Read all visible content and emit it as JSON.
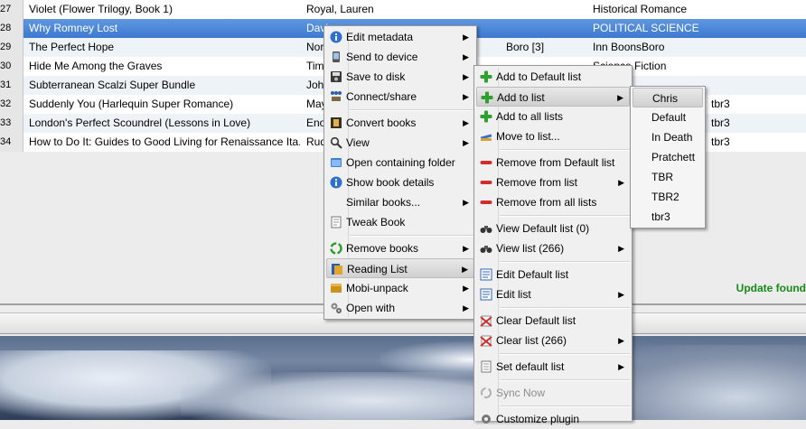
{
  "books": [
    {
      "num": "27",
      "title": "Violet (Flower Trilogy, Book 1)",
      "author": "Royal, Lauren",
      "series_num": "",
      "tags": "Historical Romance",
      "extra": ""
    },
    {
      "num": "28",
      "title": "Why Romney Lost",
      "author": "Davi",
      "series_num": "",
      "tags": "POLITICAL SCIENCE",
      "extra": ""
    },
    {
      "num": "29",
      "title": "The Perfect Hope",
      "author": "Nor",
      "series_num": "Boro [3]",
      "tags": "Inn BoonsBoro",
      "extra": ""
    },
    {
      "num": "30",
      "title": "Hide Me Among the Graves",
      "author": "Tim",
      "series_num": "",
      "tags": "Science Fiction",
      "extra": ""
    },
    {
      "num": "31",
      "title": "Subterranean Scalzi Super Bundle",
      "author": "John",
      "series_num": "",
      "tags": "Fiction",
      "extra": ""
    },
    {
      "num": "32",
      "title": "Suddenly You (Harlequin Super Romance)",
      "author": "May",
      "series_num": "",
      "tags": "",
      "extra": "tbr3"
    },
    {
      "num": "33",
      "title": "London's Perfect Scoundrel (Lessons in Love)",
      "author": "Eno",
      "series_num": "",
      "tags": "",
      "extra": "tbr3"
    },
    {
      "num": "34",
      "title": "How to Do It: Guides to Good Living for Renaissance Ita...",
      "author": "Rud",
      "series_num": "",
      "tags": "",
      "extra": "tbr3"
    }
  ],
  "status_text": "Update found",
  "context_menu": {
    "items": [
      {
        "label": "Edit metadata",
        "icon": "info-icon",
        "submenu": true
      },
      {
        "label": "Send to device",
        "icon": "device-icon",
        "submenu": true
      },
      {
        "label": "Save to disk",
        "icon": "disk-icon",
        "submenu": true
      },
      {
        "label": "Connect/share",
        "icon": "network-icon",
        "submenu": true
      },
      {
        "label": "Convert books",
        "icon": "convert-icon",
        "submenu": true
      },
      {
        "label": "View",
        "icon": "magnifier-icon",
        "submenu": true
      },
      {
        "label": "Open containing folder",
        "icon": "folder-icon",
        "submenu": false
      },
      {
        "label": "Show book details",
        "icon": "info-icon",
        "submenu": false
      },
      {
        "label": "Similar books...",
        "icon": "",
        "submenu": true
      },
      {
        "label": "Tweak Book",
        "icon": "tweak-icon",
        "submenu": false
      },
      {
        "label": "Remove books",
        "icon": "recycle-icon",
        "submenu": true
      },
      {
        "label": "Reading List",
        "icon": "reading-list-icon",
        "submenu": true
      },
      {
        "label": "Mobi-unpack",
        "icon": "unpack-icon",
        "submenu": true
      },
      {
        "label": "Open with",
        "icon": "gears-icon",
        "submenu": true
      }
    ]
  },
  "reading_list_menu": {
    "items": [
      {
        "label": "Add to Default list",
        "submenu": false
      },
      {
        "label": "Add to list",
        "submenu": true
      },
      {
        "label": "Add to all lists",
        "submenu": false
      },
      {
        "label": "Move to list...",
        "submenu": false
      },
      {
        "label": "Remove from Default list",
        "submenu": false
      },
      {
        "label": "Remove from list",
        "submenu": true
      },
      {
        "label": "Remove from all lists",
        "submenu": false
      },
      {
        "label": "View Default list (0)",
        "submenu": false
      },
      {
        "label": "View list (266)",
        "submenu": true
      },
      {
        "label": "Edit Default list",
        "submenu": false
      },
      {
        "label": "Edit list",
        "submenu": true
      },
      {
        "label": "Clear Default list",
        "submenu": false
      },
      {
        "label": "Clear list (266)",
        "submenu": true
      },
      {
        "label": "Set default list",
        "submenu": true
      },
      {
        "label": "Sync Now",
        "submenu": false
      },
      {
        "label": "Customize plugin",
        "submenu": false
      }
    ]
  },
  "list_names": [
    "Chris",
    "Default",
    "In Death",
    "Pratchett",
    "TBR",
    "TBR2",
    "tbr3"
  ]
}
